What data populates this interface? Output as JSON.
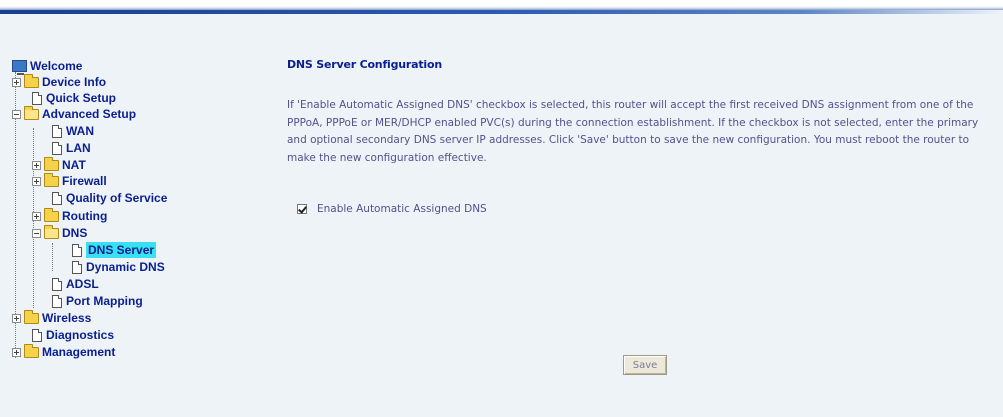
{
  "tree": {
    "welcome": "Welcome",
    "device_info": "Device Info",
    "quick_setup": "Quick Setup",
    "advanced_setup": "Advanced Setup",
    "wan": "WAN",
    "lan": "LAN",
    "nat": "NAT",
    "firewall": "Firewall",
    "qos": "Quality of Service",
    "routing": "Routing",
    "dns": "DNS",
    "dns_server": "DNS Server",
    "dynamic_dns": "Dynamic DNS",
    "adsl": "ADSL",
    "port_mapping": "Port Mapping",
    "wireless": "Wireless",
    "diagnostics": "Diagnostics",
    "management": "Management"
  },
  "main": {
    "title": "DNS Server Configuration",
    "description": "If 'Enable Automatic Assigned DNS' checkbox is selected, this router will accept the first received DNS assignment from one of the PPPoA, PPPoE or MER/DHCP enabled PVC(s) during the connection establishment. If the checkbox is not selected, enter the primary and optional secondary DNS server IP addresses. Click 'Save' button to save the new configuration. You must reboot the router to make the new configuration effective.",
    "checkbox_label": "Enable Automatic Assigned DNS",
    "checkbox_checked": true,
    "save_label": "Save"
  },
  "colors": {
    "selected_bg": "#38e0f2",
    "tree_text": "#0a1f8f",
    "body_text": "#52528c"
  }
}
